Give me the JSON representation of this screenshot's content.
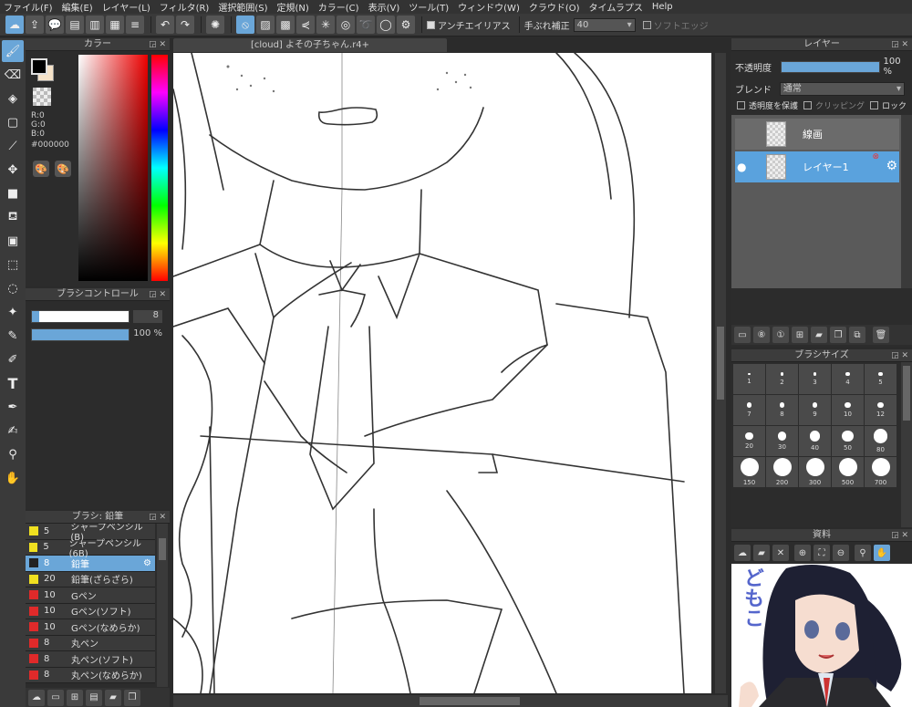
{
  "menu": [
    "ファイル(F)",
    "編集(E)",
    "レイヤー(L)",
    "フィルタ(R)",
    "選択範囲(S)",
    "定規(N)",
    "カラー(C)",
    "表示(V)",
    "ツール(T)",
    "ウィンドウ(W)",
    "クラウド(O)",
    "タイムラプス",
    "Help"
  ],
  "toolbar": {
    "antialias_label": "アンチエイリアス",
    "stabilizer_label": "手ぶれ補正",
    "stabilizer_value": "40",
    "softedge_label": "ソフトエッジ"
  },
  "color_panel": {
    "title": "カラー",
    "r": "R:0",
    "g": "G:0",
    "b": "B:0",
    "hex": "#000000",
    "fg": "#000000",
    "bg": "#f5e2c8"
  },
  "brush_control": {
    "title": "ブラシコントロール",
    "size_value": "8",
    "opacity_value": "100 %",
    "size_fraction": 0.08,
    "opacity_fraction": 1.0
  },
  "brush_list": {
    "title": "ブラシ: 鉛筆",
    "items": [
      {
        "num": "5",
        "name": "シャープペンシル(B)",
        "color": "#f0e020"
      },
      {
        "num": "5",
        "name": "シャープペンシル(6B)",
        "color": "#f0e020"
      },
      {
        "num": "8",
        "name": "鉛筆",
        "color": "#f0e020"
      },
      {
        "num": "20",
        "name": "鉛筆(ざらざら)",
        "color": "#f0e020"
      },
      {
        "num": "10",
        "name": "Gペン",
        "color": "#e02a2a"
      },
      {
        "num": "10",
        "name": "Gペン(ソフト)",
        "color": "#e02a2a"
      },
      {
        "num": "10",
        "name": "Gペン(なめらか)",
        "color": "#e02a2a"
      },
      {
        "num": "8",
        "name": "丸ペン",
        "color": "#e02a2a"
      },
      {
        "num": "8",
        "name": "丸ペン(ソフト)",
        "color": "#e02a2a"
      },
      {
        "num": "8",
        "name": "丸ペン(なめらか)",
        "color": "#e02a2a"
      }
    ],
    "selected": 2
  },
  "canvas": {
    "tab_title": "[cloud] よその子ちゃん.r4+"
  },
  "layer_panel": {
    "title": "レイヤー",
    "opacity_label": "不透明度",
    "opacity_value": "100 %",
    "opacity_fraction": 1.0,
    "blend_label": "ブレンド",
    "blend_value": "通常",
    "protect_label": "透明度を保護",
    "clipping_label": "クリッピング",
    "lock_label": "ロック",
    "layers": [
      {
        "name": "線画",
        "selected": false
      },
      {
        "name": "レイヤー1",
        "selected": true
      }
    ]
  },
  "brush_size": {
    "title": "ブラシサイズ",
    "sizes": [
      "1",
      "2",
      "3",
      "4",
      "5",
      "7",
      "8",
      "9",
      "10",
      "12",
      "20",
      "30",
      "40",
      "50",
      "80",
      "150",
      "200",
      "300",
      "500",
      "700"
    ]
  },
  "material": {
    "title": "資料",
    "image_text": "どもこ"
  }
}
